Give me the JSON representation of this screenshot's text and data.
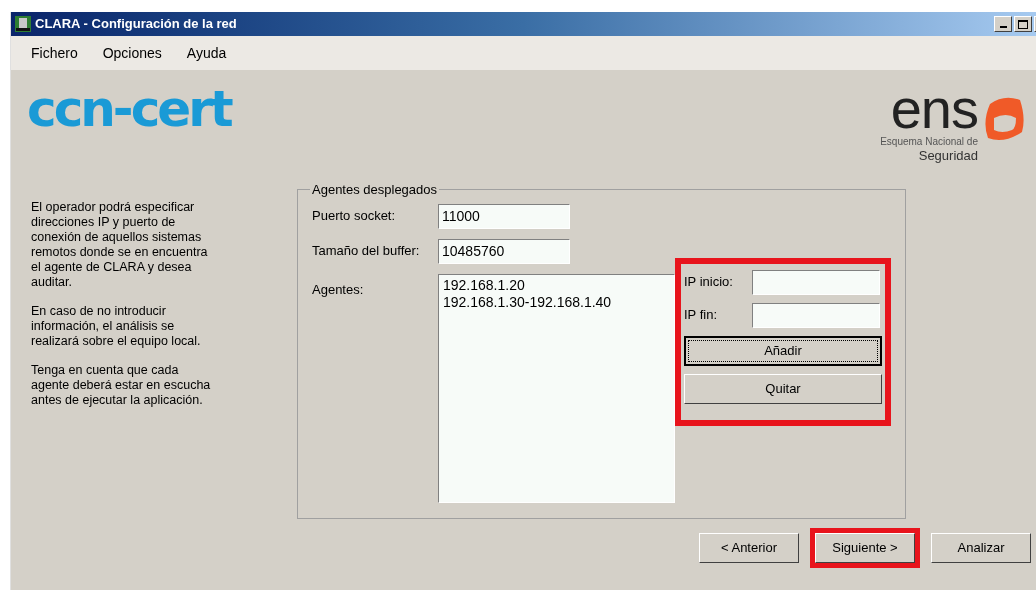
{
  "window": {
    "title": "CLARA - Configuración de la red"
  },
  "menu": [
    "Fichero",
    "Opciones",
    "Ayuda"
  ],
  "logos": {
    "left": "ccn-cert",
    "right": {
      "mark": "ens",
      "line1": "Esquema Nacional de",
      "line2": "Seguridad"
    }
  },
  "help_text": [
    "El operador podrá especificar direcciones IP y puerto de conexión de aquellos sistemas remotos donde se en encuentra el agente de CLARA y desea auditar.",
    "En caso de no introducir información, el análisis se realizará sobre el equipo local.",
    "Tenga en cuenta que cada agente deberá estar en escucha antes de ejecutar la aplicación."
  ],
  "group": {
    "title": "Agentes desplegados",
    "fields": [
      {
        "label": "Puerto socket:",
        "value": "11000"
      },
      {
        "label": "Tamaño del buffer:",
        "value": "10485760"
      }
    ],
    "agents_label": "Agentes:",
    "agents": [
      "192.168.1.20",
      "192.168.1.30-192.168.1.40"
    ],
    "range_panel": {
      "highlighted": true,
      "fields": [
        {
          "label": "IP inicio:"
        },
        {
          "label": "IP fin:"
        }
      ],
      "buttons": [
        {
          "label": "Añadir",
          "focused": true
        },
        {
          "label": "Quitar",
          "focused": false
        }
      ]
    }
  },
  "nav_buttons": [
    {
      "label": "< Anterior",
      "highlighted": false
    },
    {
      "label": "Siguiente >",
      "highlighted": true
    },
    {
      "label": "Analizar",
      "highlighted": false
    }
  ]
}
